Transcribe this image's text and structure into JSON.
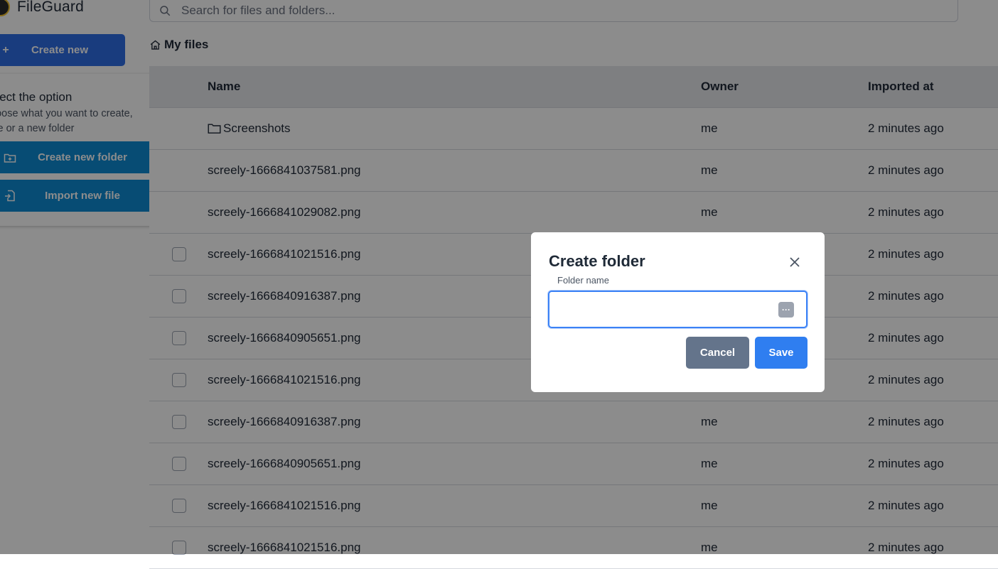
{
  "app": {
    "name": "FileGuard"
  },
  "search": {
    "placeholder": "Search for files and folders..."
  },
  "sidebar": {
    "create_new_label": "Create new",
    "option_title": "elect the option",
    "option_desc_line1": "hoose what you want to create,",
    "option_desc_line2": "file or a new folder",
    "create_folder_label": "Create new folder",
    "import_file_label": "Import new file"
  },
  "breadcrumb": {
    "label": "My files"
  },
  "table": {
    "headers": {
      "name": "Name",
      "owner": "Owner",
      "imported": "Imported at"
    },
    "rows": [
      {
        "name": "Screenshots",
        "owner": "me",
        "imported": "2 minutes ago",
        "is_folder": true
      },
      {
        "name": "screely-1666841037581.png",
        "owner": "me",
        "imported": "2 minutes ago"
      },
      {
        "name": "screely-1666841029082.png",
        "owner": "me",
        "imported": "2 minutes ago"
      },
      {
        "name": "screely-1666841021516.png",
        "owner": "",
        "imported": "2 minutes ago"
      },
      {
        "name": "screely-1666840916387.png",
        "owner": "",
        "imported": "2 minutes ago"
      },
      {
        "name": "screely-1666840905651.png",
        "owner": "",
        "imported": "2 minutes ago"
      },
      {
        "name": "screely-1666841021516.png",
        "owner": "",
        "imported": "2 minutes ago"
      },
      {
        "name": "screely-1666840916387.png",
        "owner": "me",
        "imported": "2 minutes ago"
      },
      {
        "name": "screely-1666840905651.png",
        "owner": "me",
        "imported": "2 minutes ago"
      },
      {
        "name": "screely-1666841021516.png",
        "owner": "me",
        "imported": "2 minutes ago"
      },
      {
        "name": "screely-1666841021516.png",
        "owner": "me",
        "imported": "2 minutes ago"
      }
    ]
  },
  "modal": {
    "title": "Create folder",
    "field_label": "Folder name",
    "field_value": "",
    "field_icon": "password-manager-icon",
    "cancel_label": "Cancel",
    "save_label": "Save"
  },
  "colors": {
    "primary": "#2f6ee6",
    "option_button": "#0e8ad4",
    "cancel": "#64748b",
    "save": "#2f7ef0",
    "overlay": "rgba(0,0,0,0.45)"
  }
}
